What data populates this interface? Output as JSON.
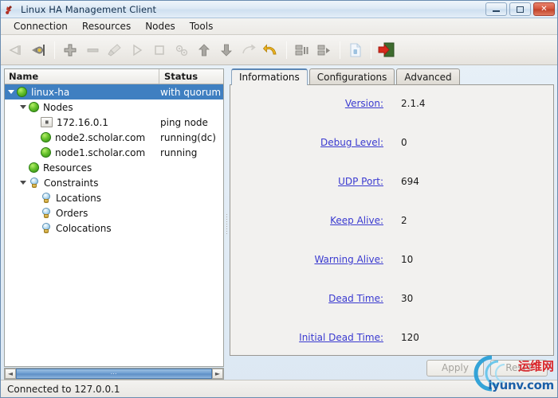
{
  "window": {
    "title": "Linux HA Management Client",
    "icon": "app-icon",
    "controls": {
      "minimize": "–",
      "maximize": "□",
      "close": "✕"
    }
  },
  "menubar": {
    "items": [
      {
        "label": "Connection"
      },
      {
        "label": "Resources"
      },
      {
        "label": "Nodes"
      },
      {
        "label": "Tools"
      }
    ]
  },
  "toolbar": {
    "buttons": [
      {
        "name": "connect-icon",
        "enabled": false
      },
      {
        "name": "disconnect-plug-icon",
        "enabled": true
      },
      {
        "name": "add-icon",
        "enabled": true
      },
      {
        "name": "remove-icon",
        "enabled": false
      },
      {
        "name": "cleanup-brush-icon",
        "enabled": false
      },
      {
        "name": "start-play-icon",
        "enabled": false
      },
      {
        "name": "stop-square-icon",
        "enabled": false
      },
      {
        "name": "manage-gears-icon",
        "enabled": false
      },
      {
        "name": "move-up-icon",
        "enabled": true
      },
      {
        "name": "move-down-icon",
        "enabled": true
      },
      {
        "name": "migrate-icon",
        "enabled": false
      },
      {
        "name": "unmigrate-undo-icon",
        "enabled": true
      },
      {
        "name": "standby-icon",
        "enabled": true
      },
      {
        "name": "active-icon",
        "enabled": true
      },
      {
        "name": "document-icon",
        "enabled": false
      },
      {
        "name": "exit-door-icon",
        "enabled": true
      }
    ]
  },
  "tree": {
    "columns": {
      "name": "Name",
      "status": "Status"
    },
    "rows": [
      {
        "label": "linux-ha",
        "status": "with quorum",
        "icon": "green-ball-icon",
        "indent": 0,
        "expanded": true,
        "selected": true
      },
      {
        "label": "Nodes",
        "status": "",
        "icon": "green-ball-icon",
        "indent": 1,
        "expanded": true,
        "selected": false
      },
      {
        "label": "172.16.0.1",
        "status": "ping node",
        "icon": "ping-node-icon",
        "indent": 2,
        "expanded": null,
        "selected": false
      },
      {
        "label": "node2.scholar.com",
        "status": "running(dc)",
        "icon": "green-ball-icon",
        "indent": 2,
        "expanded": null,
        "selected": false
      },
      {
        "label": "node1.scholar.com",
        "status": "running",
        "icon": "green-ball-icon",
        "indent": 2,
        "expanded": null,
        "selected": false
      },
      {
        "label": "Resources",
        "status": "",
        "icon": "green-ball-icon",
        "indent": 1,
        "expanded": null,
        "selected": false
      },
      {
        "label": "Constraints",
        "status": "",
        "icon": "lightbulb-icon",
        "indent": 1,
        "expanded": true,
        "selected": false
      },
      {
        "label": "Locations",
        "status": "",
        "icon": "lightbulb-icon",
        "indent": 2,
        "expanded": null,
        "selected": false
      },
      {
        "label": "Orders",
        "status": "",
        "icon": "lightbulb-icon",
        "indent": 2,
        "expanded": null,
        "selected": false
      },
      {
        "label": "Colocations",
        "status": "",
        "icon": "lightbulb-icon",
        "indent": 2,
        "expanded": null,
        "selected": false
      }
    ],
    "scroll": {
      "left_arrow": "◄",
      "right_arrow": "►",
      "grip": "⋯"
    }
  },
  "tabs": [
    {
      "label": "Informations",
      "active": true
    },
    {
      "label": "Configurations",
      "active": false
    },
    {
      "label": "Advanced",
      "active": false
    }
  ],
  "info_panel": {
    "fields": [
      {
        "label": "Version:",
        "value": "2.1.4"
      },
      {
        "label": "Debug Level:",
        "value": "0"
      },
      {
        "label": "UDP Port:",
        "value": "694"
      },
      {
        "label": "Keep Alive:",
        "value": "2"
      },
      {
        "label": "Warning Alive:",
        "value": "10"
      },
      {
        "label": "Dead Time:",
        "value": "30"
      },
      {
        "label": "Initial Dead Time:",
        "value": "120"
      }
    ]
  },
  "buttons": {
    "apply": "Apply",
    "reset": "Reset"
  },
  "statusbar": {
    "text": "Connected to 127.0.0.1"
  },
  "watermark": {
    "cn": "运维网",
    "en": "iyunv.com"
  },
  "colors": {
    "selection": "#3f7fc1",
    "link": "#3a3ad0",
    "node_green": "#66c22c",
    "close_red": "#d4543a"
  }
}
